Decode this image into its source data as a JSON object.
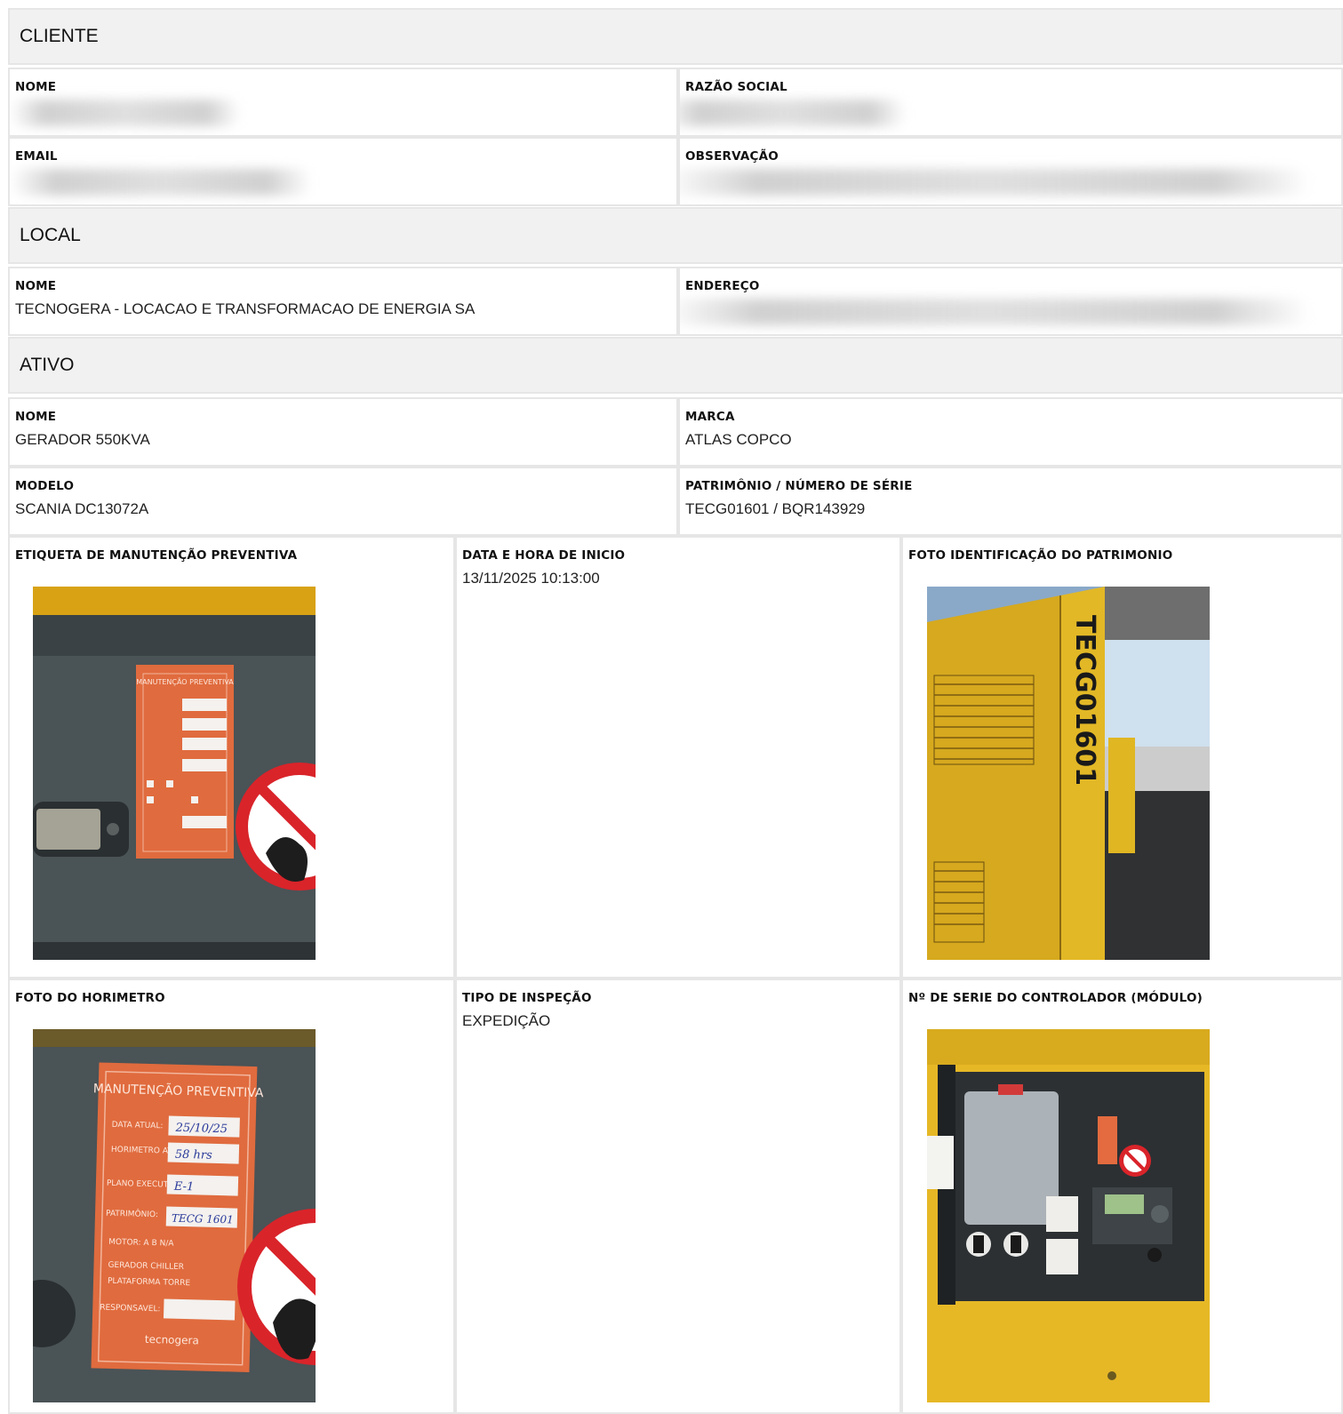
{
  "cliente": {
    "title": "CLIENTE",
    "nome_label": "NOME",
    "razao_label": "RAZÃO SOCIAL",
    "email_label": "EMAIL",
    "obs_label": "OBSERVAÇÃO"
  },
  "local": {
    "title": "LOCAL",
    "nome_label": "NOME",
    "nome_value": "TECNOGERA - LOCACAO E TRANSFORMACAO DE ENERGIA SA",
    "endereco_label": "ENDEREÇO"
  },
  "ativo": {
    "title": "ATIVO",
    "nome_label": "NOME",
    "nome_value": "GERADOR 550KVA",
    "marca_label": "MARCA",
    "marca_value": "ATLAS COPCO",
    "modelo_label": "MODELO",
    "modelo_value": "SCANIA DC13072A",
    "patrimonio_label": "PATRIMÔNIO / NÚMERO DE SÉRIE",
    "patrimonio_value": "TECG01601 / BQR143929"
  },
  "inspection": {
    "etiqueta_label": "ETIQUETA DE MANUTENÇÃO PREVENTIVA",
    "data_label": "DATA E HORA DE INICIO",
    "data_value": "13/11/2025 10:13:00",
    "foto_id_label": "FOTO IDENTIFICAÇÃO DO PATRIMONIO",
    "horimetro_label": "FOTO DO HORIMETRO",
    "tipo_label": "TIPO DE INSPEÇÃO",
    "tipo_value": "EXPEDIÇÃO",
    "serie_label": "Nº DE SERIE DO CONTROLADOR (MÓDULO)"
  },
  "photos": {
    "sticker_title": "MANUTENÇÃO PREVENTIVA",
    "sticker_date_label": "DATA ATUAL:",
    "sticker_date": "25/10/25",
    "sticker_hor_label": "HORIMETRO ATUAL:",
    "sticker_hor": "58 hrs",
    "sticker_plano_label": "PLANO EXECUTADO:",
    "sticker_plano": "E-1",
    "sticker_pat_label": "PATRIMÔNIO:",
    "sticker_pat": "TECG 1601",
    "sticker_motor": "MOTOR:  A   B  N/A",
    "sticker_opts1": "GERADOR   CHILLER",
    "sticker_opts2": "PLATAFORMA   TORRE",
    "sticker_resp_label": "RESPONSAVEL:",
    "sticker_brand": "tecnogera",
    "asset_code": "TECG01601"
  }
}
